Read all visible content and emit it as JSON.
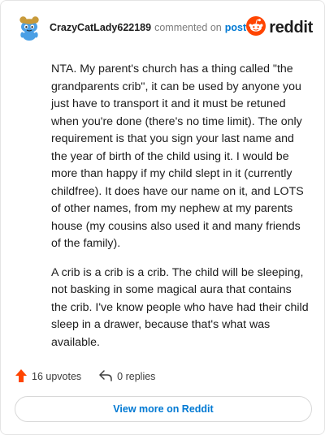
{
  "header": {
    "username": "CrazyCatLady622189",
    "commented_text": "commented on",
    "post_link": "post",
    "brand_word": "reddit"
  },
  "comment": {
    "paragraphs": [
      "NTA. My parent's church has a thing called \"the grandparents crib\", it can be used by anyone you just have to transport it and it must be retuned when you're done (there's no time limit). The only requirement is that you sign your last name and the year of birth of the child using it. I would be more than happy if my child slept in it (currently childfree). It does have our name on it, and LOTS of other names, from my nephew at my parents house (my cousins also used it and many friends of the family).",
      "A crib is a crib is a crib. The child will be sleeping, not basking in some magical aura that contains the crib. I've know people who have had their child sleep in a drawer, because that's what was available."
    ]
  },
  "actions": {
    "upvotes": "16 upvotes",
    "replies": "0 replies"
  },
  "footer": {
    "view_more": "View more on Reddit"
  },
  "colors": {
    "upvote_orange": "#ff4500",
    "link_blue": "#0079d3",
    "avatar_blue": "#4a9fe5",
    "hat_gold": "#c89a3a"
  },
  "icons": {
    "avatar": "snoo-avatar-icon",
    "brand": "reddit-logo-icon",
    "upvote": "upvote-arrow-icon",
    "reply": "reply-arrow-icon"
  }
}
